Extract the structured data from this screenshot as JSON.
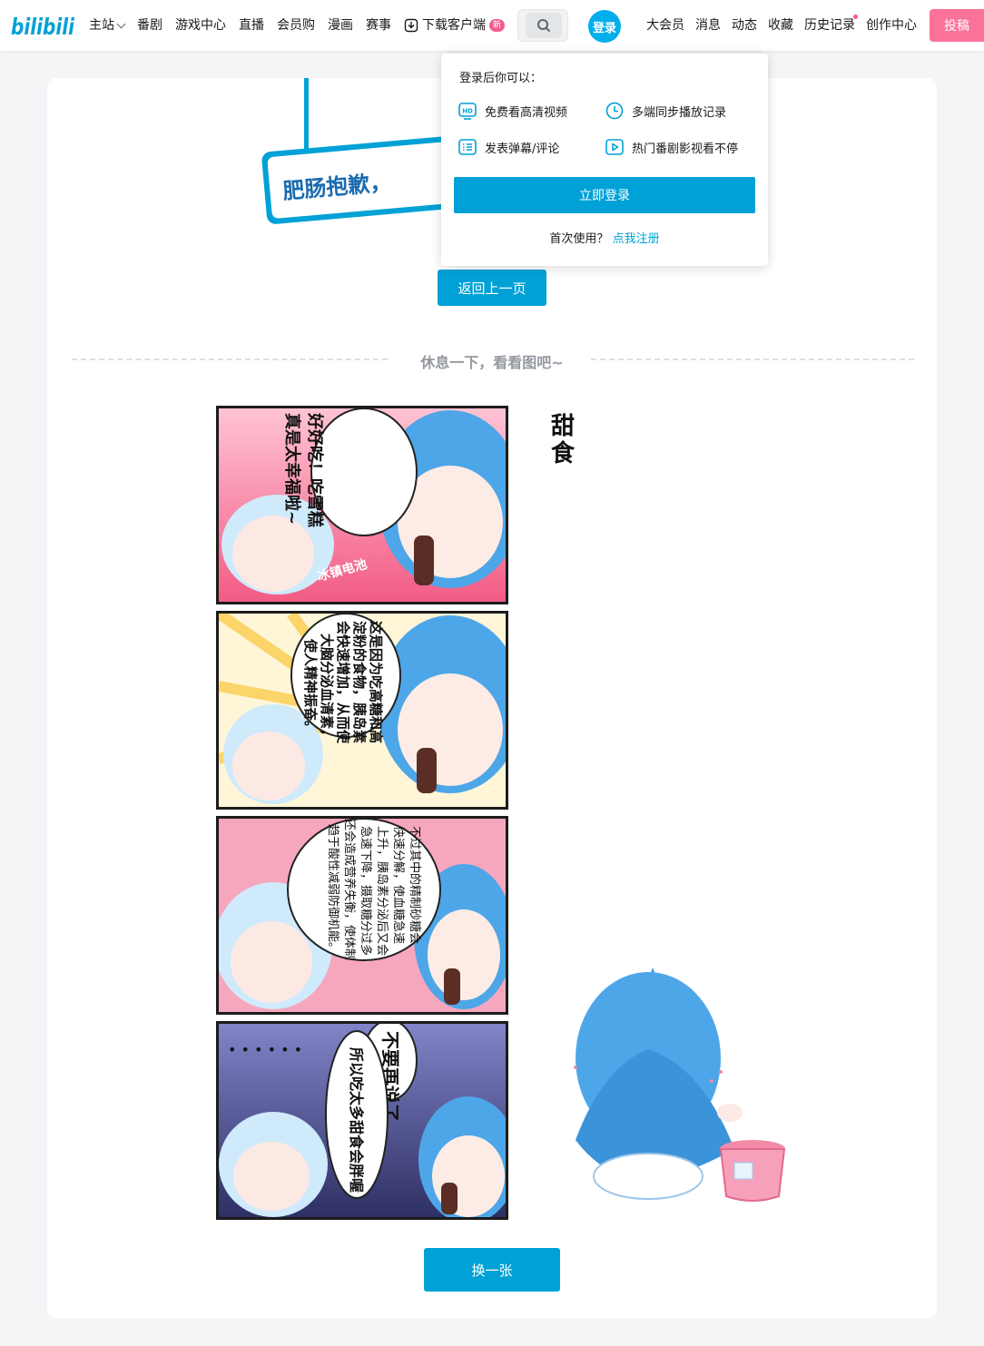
{
  "nav": {
    "logo": "bilibili",
    "items": [
      "主站",
      "番剧",
      "游戏中心",
      "直播",
      "会员购",
      "漫画",
      "赛事"
    ],
    "download": "下载客户端",
    "download_badge": "新",
    "login": "登录",
    "right_items": [
      "大会员",
      "消息",
      "动态",
      "收藏",
      "历史记录",
      "创作中心"
    ],
    "upload": "投稿"
  },
  "error": {
    "sign_text": "肥肠抱歉，",
    "back_button": "返回上一页"
  },
  "divider": "休息一下，看看图吧~",
  "comic": {
    "side_title": "甜食",
    "panels": [
      {
        "lines": [
          "好好吃！吃雪糕",
          "真是太幸福啦~"
        ],
        "tag": "冰镇电池"
      },
      {
        "lines": [
          "这是因为吃高糖和高",
          "淀粉的食物，胰岛素",
          "会快速增加，从而使",
          "大脑分泌血清素，",
          "使人精神振奋。"
        ]
      },
      {
        "lines": [
          "不过其中的精制砂糖会",
          "快速分解，使血糖急速",
          "上升，胰岛素分泌后又会",
          "急速下降，摄取糖分过多",
          "还会造成营养失衡，使体制",
          "趋于酸性减弱防御机能。"
        ]
      },
      {
        "lines": [
          "不要再说了",
          "所以吃太多甜食会胖喔"
        ],
        "dots": "• • • • • •"
      }
    ]
  },
  "swap_button": "换一张",
  "popover": {
    "title": "登录后你可以：",
    "perks": [
      "免费看高清视频",
      "多端同步播放记录",
      "发表弹幕/评论",
      "热门番剧影视看不停"
    ],
    "login_button": "立即登录",
    "register_prompt": "首次使用？",
    "register_link": "点我注册"
  },
  "colors": {
    "accent": "#00a1d6",
    "pink": "#fb7299",
    "background": "#f4f5f7"
  }
}
